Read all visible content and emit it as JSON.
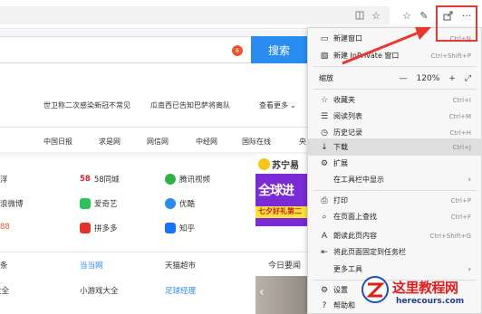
{
  "toolbar": {
    "icons": [
      "reading-view-icon",
      "favorite-star-icon",
      "favorites-list-icon",
      "pen-icon",
      "share-icon",
      "more-icon"
    ],
    "more_label": "···"
  },
  "page": {
    "search_badge": "6",
    "search_button": "搜索",
    "news": [
      "世卫称二次感染新冠不常见",
      "瓜南西已告知巴萨将离队",
      "查看更多"
    ],
    "news_more_chevron": "⌄",
    "sites": [
      "中国日报",
      "求是网",
      "网信网",
      "中经网",
      "国际在线",
      "央"
    ],
    "grid": {
      "r1": [
        "浮",
        "58同城",
        "腾讯视频"
      ],
      "r1_prefix": "58",
      "r2": [
        "浪微博",
        "爱奇艺",
        "优酷"
      ],
      "r3": [
        "88",
        "拼多多",
        "知乎"
      ],
      "r4": [
        "条",
        "当当网",
        "天猫超市"
      ],
      "r5": [
        "游戏大全",
        "小游戏大全",
        "足球经理"
      ]
    },
    "ad": {
      "brand": "苏宁易",
      "title": "全球进",
      "sub": "七夕好礼第二"
    },
    "today": "今日要闻"
  },
  "menu": {
    "items": [
      {
        "icon": "new-window-icon",
        "label": "新建窗口",
        "shortcut": "Ctrl+N"
      },
      {
        "icon": "inprivate-icon",
        "label": "新建 InPrivate 窗口",
        "shortcut": "Ctrl+Shift+P"
      },
      {
        "label": "缩放",
        "zoom_minus": "—",
        "zoom_value": "120%",
        "zoom_plus": "+",
        "zoom_full": "⤢"
      },
      {
        "icon": "favorites-icon",
        "label": "收藏夹",
        "shortcut": "Ctrl+I"
      },
      {
        "icon": "reading-list-icon",
        "label": "阅读列表",
        "shortcut": "Ctrl+M"
      },
      {
        "icon": "history-icon",
        "label": "历史记录",
        "shortcut": "Ctrl+H"
      },
      {
        "icon": "download-icon",
        "label": "下载",
        "shortcut": "Ctrl+J"
      },
      {
        "icon": "extensions-icon",
        "label": "扩展"
      },
      {
        "label": "在工具栏中显示",
        "arrow": "›"
      },
      {
        "icon": "print-icon",
        "label": "打印",
        "shortcut": "Ctrl+P"
      },
      {
        "icon": "find-icon",
        "label": "在页面上查找",
        "shortcut": "Ctrl+F"
      },
      {
        "icon": "read-aloud-icon",
        "label": "朗读此页内容",
        "shortcut": "Ctrl+Shift+G"
      },
      {
        "icon": "pin-icon",
        "label": "将此页面固定到任务栏"
      },
      {
        "label": "更多工具",
        "arrow": "›"
      },
      {
        "icon": "settings-icon",
        "label": "设置"
      },
      {
        "icon": "help-icon",
        "label": "帮助和"
      }
    ]
  },
  "watermark": {
    "title": "这里教程网",
    "url": "herecours.com"
  },
  "colors": {
    "annotation_red": "#e8372f",
    "search_blue": "#2a8cf0",
    "ad_purple": "#7a2bd6",
    "watermark_red": "#e01d1d",
    "watermark_blue": "#1f4fb8"
  }
}
